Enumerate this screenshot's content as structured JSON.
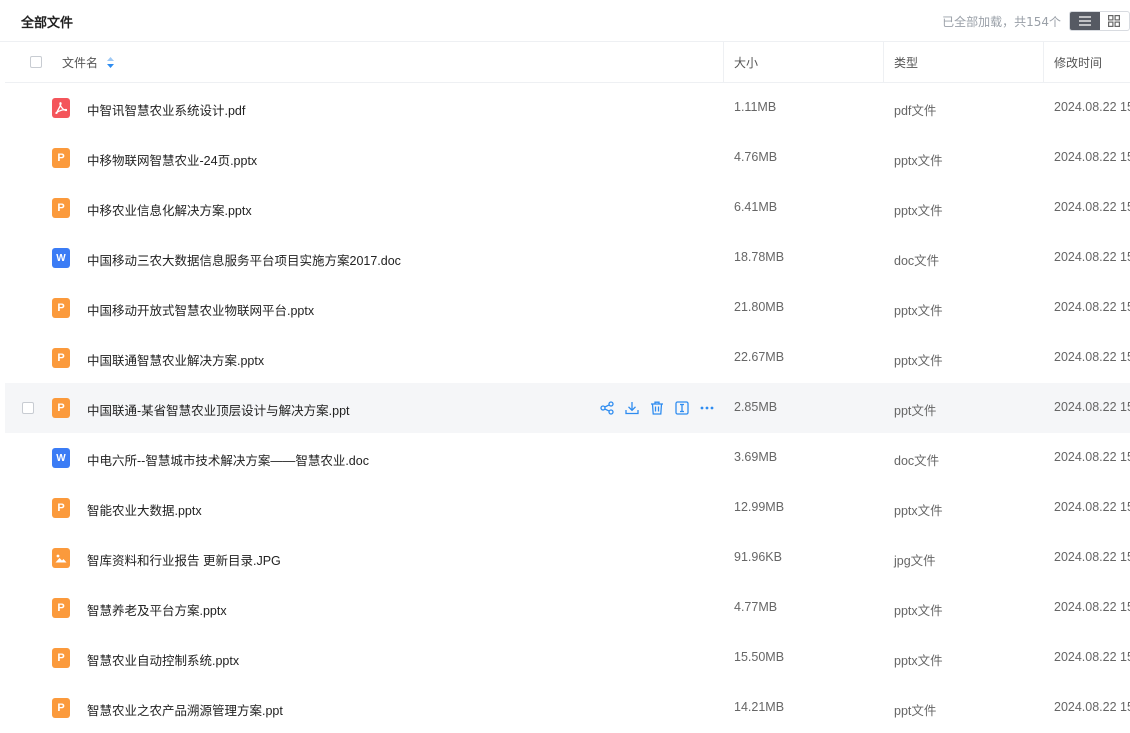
{
  "toolbar": {
    "title": "全部文件",
    "status": "已全部加载，共154个"
  },
  "columns": {
    "name": "文件名",
    "size": "大小",
    "type": "类型",
    "modified": "修改时间"
  },
  "colors": {
    "pdf": "#f4555b",
    "ppt": "#fb9a3c",
    "doc": "#3b7cf5",
    "jpg": "#fb9a3c",
    "accent": "#2e8cf0"
  },
  "files": [
    {
      "name": "中智讯智慧农业系统设计.pdf",
      "size": "1.11MB",
      "type": "pdf文件",
      "modified": "2024.08.22 15",
      "icon": "pdf-file-icon"
    },
    {
      "name": "中移物联网智慧农业-24页.pptx",
      "size": "4.76MB",
      "type": "pptx文件",
      "modified": "2024.08.22 15",
      "icon": "ppt-file-icon"
    },
    {
      "name": "中移农业信息化解决方案.pptx",
      "size": "6.41MB",
      "type": "pptx文件",
      "modified": "2024.08.22 15",
      "icon": "ppt-file-icon"
    },
    {
      "name": "中国移动三农大数据信息服务平台项目实施方案2017.doc",
      "size": "18.78MB",
      "type": "doc文件",
      "modified": "2024.08.22 15",
      "icon": "doc-file-icon"
    },
    {
      "name": "中国移动开放式智慧农业物联网平台.pptx",
      "size": "21.80MB",
      "type": "pptx文件",
      "modified": "2024.08.22 15",
      "icon": "ppt-file-icon"
    },
    {
      "name": "中国联通智慧农业解决方案.pptx",
      "size": "22.67MB",
      "type": "pptx文件",
      "modified": "2024.08.22 15",
      "icon": "ppt-file-icon"
    },
    {
      "name": "中国联通-某省智慧农业顶层设计与解决方案.ppt",
      "size": "2.85MB",
      "type": "ppt文件",
      "modified": "2024.08.22 15",
      "icon": "ppt-file-icon"
    },
    {
      "name": "中电六所--智慧城市技术解决方案——智慧农业.doc",
      "size": "3.69MB",
      "type": "doc文件",
      "modified": "2024.08.22 15",
      "icon": "doc-file-icon"
    },
    {
      "name": "智能农业大数据.pptx",
      "size": "12.99MB",
      "type": "pptx文件",
      "modified": "2024.08.22 15",
      "icon": "ppt-file-icon"
    },
    {
      "name": "智库资料和行业报告 更新目录.JPG",
      "size": "91.96KB",
      "type": "jpg文件",
      "modified": "2024.08.22 15",
      "icon": "image-file-icon"
    },
    {
      "name": "智慧养老及平台方案.pptx",
      "size": "4.77MB",
      "type": "pptx文件",
      "modified": "2024.08.22 15",
      "icon": "ppt-file-icon"
    },
    {
      "name": "智慧农业自动控制系统.pptx",
      "size": "15.50MB",
      "type": "pptx文件",
      "modified": "2024.08.22 15",
      "icon": "ppt-file-icon"
    },
    {
      "name": "智慧农业之农产品溯源管理方案.ppt",
      "size": "14.21MB",
      "type": "ppt文件",
      "modified": "2024.08.22 15",
      "icon": "ppt-file-icon"
    }
  ],
  "hovered_row": 6,
  "row_actions": [
    "share-icon",
    "download-icon",
    "delete-icon",
    "rename-icon",
    "more-icon"
  ]
}
